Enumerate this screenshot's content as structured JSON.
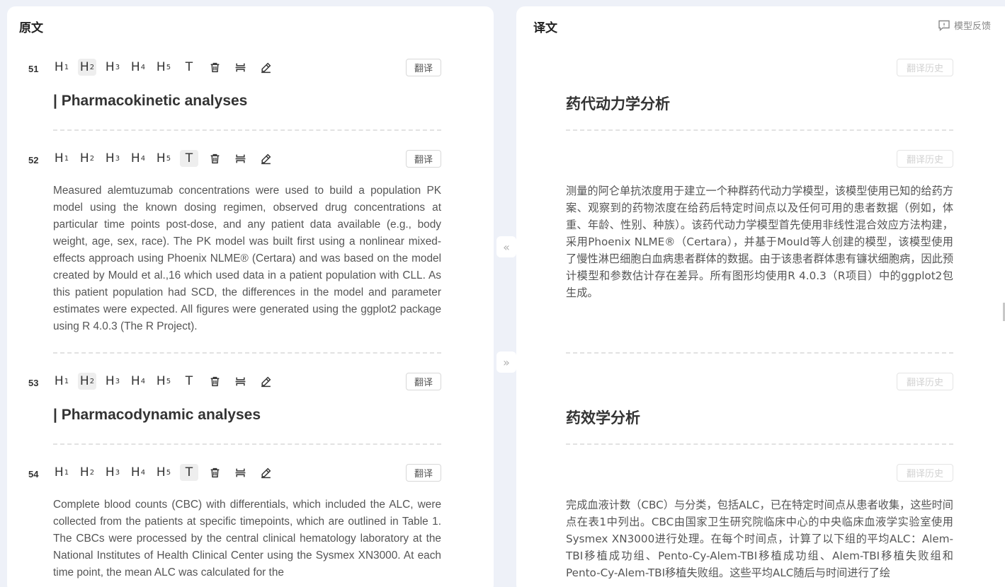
{
  "left_panel": {
    "title": "原文",
    "translate_label": "翻译",
    "toolbar_labels": [
      "H",
      "H",
      "H",
      "H",
      "H",
      "T"
    ],
    "toolbar_subs": [
      "1",
      "2",
      "3",
      "4",
      "5"
    ],
    "blocks": [
      {
        "num": "51",
        "heading": "| Pharmacokinetic analyses"
      },
      {
        "num": "52",
        "paragraph": "Measured alemtuzumab concentrations were used to build a population PK model using the known dosing regimen, observed drug concentrations at particular time points post-dose, and any patient data available (e.g., body weight, age, sex, race). The PK model was built first using a nonlinear mixed-effects approach using Phoenix NLME® (Certara) and was based on the model created by Mould et al.,16 which used data in a patient population with CLL. As this patient population had SCD, the differences in the model and parameter estimates were expected. All figures were generated using the ggplot2 package using R 4.0.3 (The R Project)."
      },
      {
        "num": "53",
        "heading": "| Pharmacodynamic analyses"
      },
      {
        "num": "54",
        "paragraph": "Complete blood counts (CBC) with differentials, which included the ALC, were collected from the patients at specific timepoints, which are outlined in Table 1. The CBCs were processed by the central clinical hematology laboratory at the National Institutes of Health Clinical Center using the Sysmex XN3000. At each time point, the mean ALC was calculated for the"
      }
    ]
  },
  "right_panel": {
    "title": "译文",
    "feedback_label": "模型反馈",
    "history_label": "翻译历史",
    "blocks": [
      {
        "heading": "药代动力学分析"
      },
      {
        "paragraph": "测量的阿仑单抗浓度用于建立一个种群药代动力学模型，该模型使用已知的给药方案、观察到的药物浓度在给药后特定时间点以及任何可用的患者数据（例如，体重、年龄、性别、种族）。该药代动力学模型首先使用非线性混合效应方法构建，采用Phoenix NLME®（Certara），并基于Mould等人创建的模型，该模型使用了慢性淋巴细胞白血病患者群体的数据。由于该患者群体患有镰状细胞病，因此预计模型和参数估计存在差异。所有图形均使用R 4.0.3（R项目）中的ggplot2包生成。"
      },
      {
        "heading": "药效学分析"
      },
      {
        "paragraph": "完成血液计数（CBC）与分类，包括ALC，已在特定时间点从患者收集，这些时间点在表1中列出。CBC由国家卫生研究院临床中心的中央临床血液学实验室使用Sysmex XN3000进行处理。在每个时间点，计算了以下组的平均ALC：Alem-TBI移植成功组、Pento-Cy-Alem-TBI移植成功组、Alem-TBI移植失败组和Pento-Cy-Alem-TBI移植失败组。这些平均ALC随后与时间进行了绘"
      }
    ]
  },
  "collapse_left": "«",
  "collapse_right": "»",
  "colors": {
    "background": "#eef1f8",
    "panel": "#ffffff",
    "text": "#555555",
    "divider": "#e2e2e2"
  }
}
